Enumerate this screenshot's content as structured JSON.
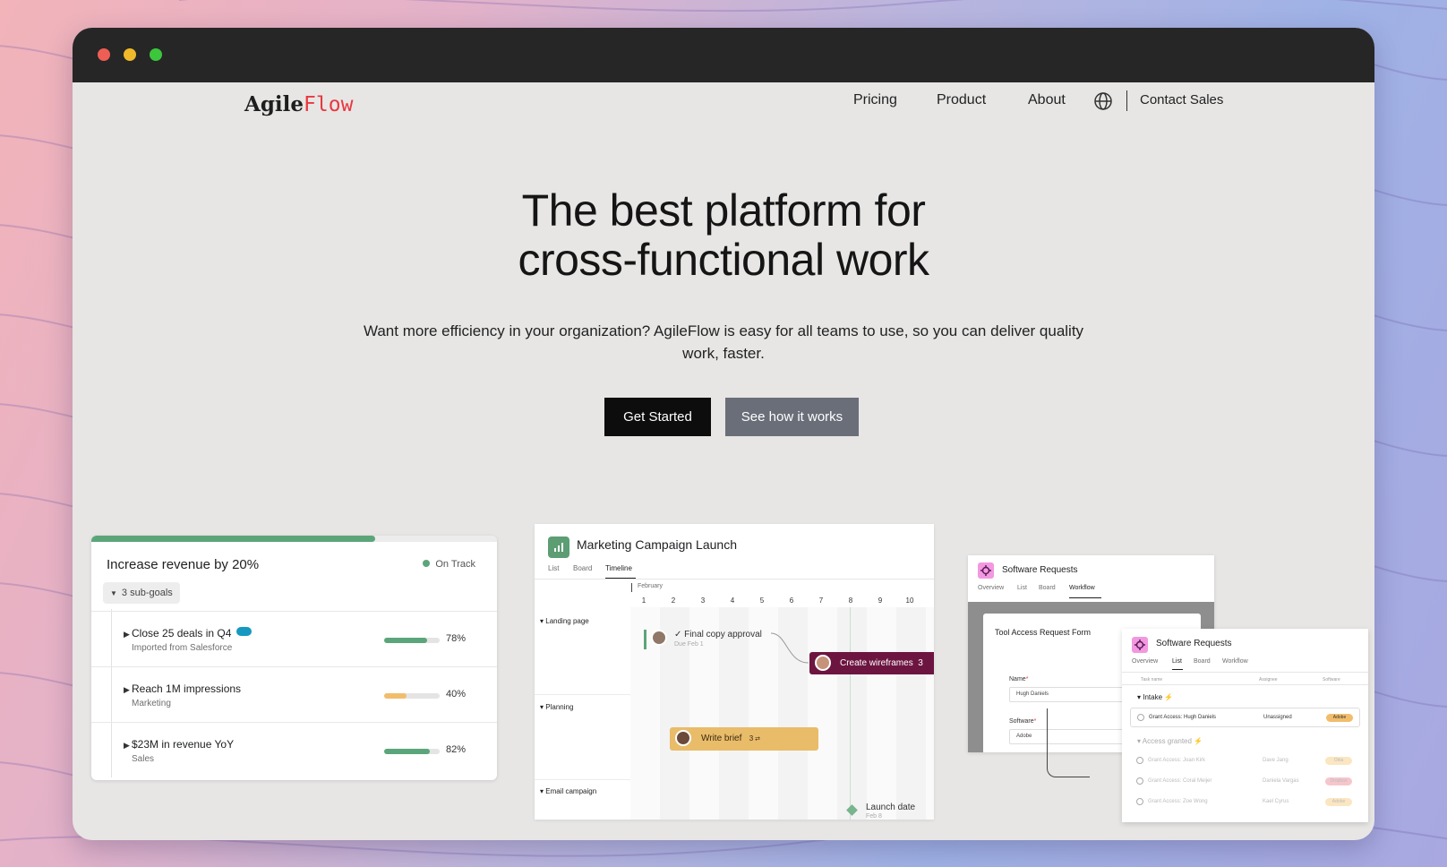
{
  "nav": {
    "logo_part1": "Agile",
    "logo_part2": "Flow",
    "items": [
      "Pricing",
      "Product",
      "About"
    ],
    "contact": "Contact Sales"
  },
  "hero": {
    "title_line1": "The best platform for",
    "title_line2": "cross-functional work",
    "subtitle": "Want more efficiency in your organization? AgileFlow is easy for all teams to use, so you can deliver quality work, faster.",
    "primary_button": "Get Started",
    "secondary_button": "See how it works"
  },
  "goals_card": {
    "title": "Increase revenue by 20%",
    "status": "On Track",
    "status_color": "#5ba57a",
    "overall_progress": 0.7,
    "subgoals_label": "3 sub-goals",
    "rows": [
      {
        "name": "Close 25 deals in Q4",
        "source": "Imported from Salesforce",
        "percent": "78%",
        "value": 0.78,
        "color": "#5ba57a"
      },
      {
        "name": "Reach 1M impressions",
        "source": "Marketing",
        "percent": "40%",
        "value": 0.4,
        "color": "#f1bd6c"
      },
      {
        "name": "$23M in revenue YoY",
        "source": "Sales",
        "percent": "82%",
        "value": 0.82,
        "color": "#5ba57a"
      }
    ]
  },
  "timeline_card": {
    "title": "Marketing Campaign Launch",
    "tabs": [
      "List",
      "Board",
      "Timeline"
    ],
    "active_tab": "Timeline",
    "month": "February",
    "days": [
      "1",
      "2",
      "3",
      "4",
      "5",
      "6",
      "7",
      "8",
      "9",
      "10"
    ],
    "sections": [
      "Landing page",
      "Planning",
      "Email campaign"
    ],
    "final_copy": "Final copy approval",
    "final_copy_due": "Due Feb 1",
    "wireframes": "Create wireframes",
    "wireframes_count": "3",
    "brief": "Write brief",
    "brief_count": "3",
    "launch": "Launch date",
    "launch_due": "Feb 8"
  },
  "requests_back": {
    "title": "Software Requests",
    "tabs": [
      "Overview",
      "List",
      "Board",
      "Workflow"
    ],
    "active_tab": "Workflow",
    "form_title": "Tool Access Request Form",
    "name_label": "Name",
    "name_value": "Hugh Daniels",
    "software_label": "Software",
    "software_value": "Adobe"
  },
  "requests_front": {
    "title": "Software Requests",
    "tabs": [
      "Overview",
      "List",
      "Board",
      "Workflow"
    ],
    "active_tab": "List",
    "columns": [
      "Task name",
      "Assignee",
      "Software"
    ],
    "group1": "Intake",
    "group2": "Access granted",
    "rows": [
      {
        "task": "Grant Access: Hugh Daniels",
        "assignee": "Unassigned",
        "software": "Adobe",
        "color": "#f1bd6c"
      },
      {
        "task": "Grant Access: Joan Kirk",
        "assignee": "Dave Jang",
        "software": "Okta",
        "color": "#fbe6c2"
      },
      {
        "task": "Grant Access: Coral Meijer",
        "assignee": "Daniela Vargas",
        "software": "Dropbox",
        "color": "#f6c6cc"
      },
      {
        "task": "Grant Access: Zoe Wong",
        "assignee": "Kael Cyrus",
        "software": "Adobe",
        "color": "#fbe6c2"
      }
    ]
  }
}
